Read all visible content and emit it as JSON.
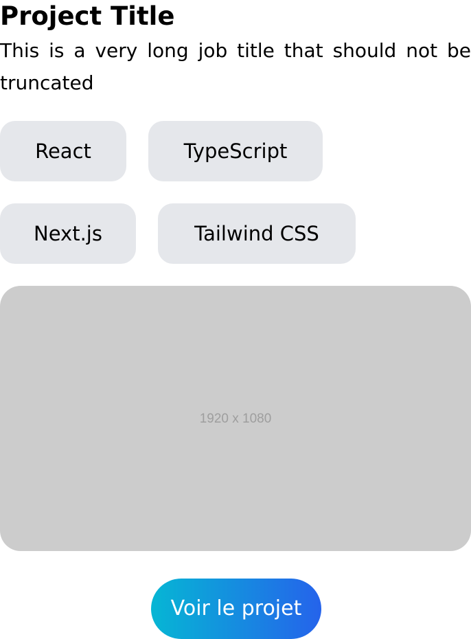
{
  "project": {
    "title": "Project Title",
    "job_title": "This is a very long job title that should not be truncated"
  },
  "tags": [
    {
      "label": "React"
    },
    {
      "label": "TypeScript"
    },
    {
      "label": "Next.js"
    },
    {
      "label": "Tailwind CSS"
    }
  ],
  "preview": {
    "placeholder_text": "1920 x 1080",
    "background_color": "#cccccc"
  },
  "cta": {
    "label": "Voir le projet",
    "gradient_colors": [
      "#06b6d4",
      "#2563eb"
    ]
  },
  "colors": {
    "tag_background": "#e5e7eb",
    "text": "#000000"
  }
}
